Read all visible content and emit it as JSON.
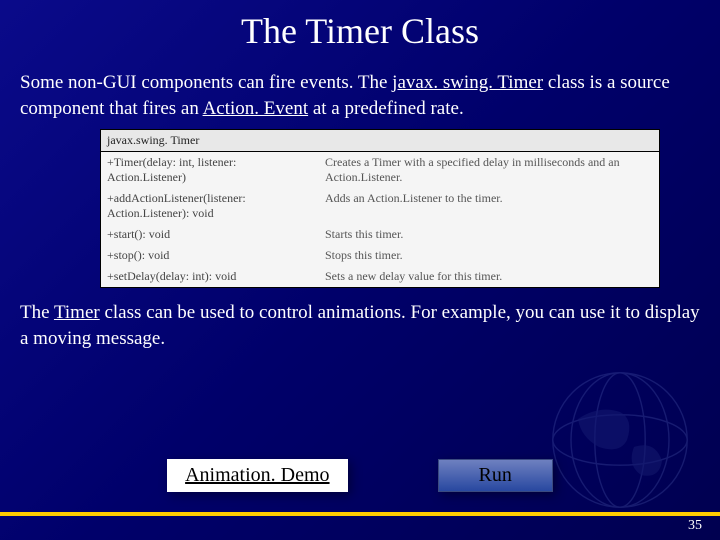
{
  "title": "The Timer Class",
  "intro_parts": {
    "p1": "Some non-GUI components can fire events. The ",
    "link1": "javax. swing. Timer",
    "p2": " class is a source component that fires an ",
    "link2": "Action. Event",
    "p3": " at a predefined rate."
  },
  "api": {
    "class_name": "javax.swing. Timer",
    "rows": [
      {
        "sig": "+Timer(delay: int, listener: Action.Listener)",
        "desc": "Creates a Timer with a specified delay in milliseconds and an Action.Listener."
      },
      {
        "sig": "+addActionListener(listener: Action.Listener): void",
        "desc": "Adds an Action.Listener to the timer."
      },
      {
        "sig": "+start(): void",
        "desc": "Starts this timer."
      },
      {
        "sig": "+stop(): void",
        "desc": "Stops this timer."
      },
      {
        "sig": "+setDelay(delay: int): void",
        "desc": "Sets a new delay value for this timer."
      }
    ]
  },
  "outro_parts": {
    "p1": "The ",
    "link1": "Timer",
    "p2": " class can be used to control animations. For example, you can use it to display a moving message."
  },
  "buttons": {
    "demo": "Animation. Demo",
    "run": "Run"
  },
  "page_number": "35"
}
